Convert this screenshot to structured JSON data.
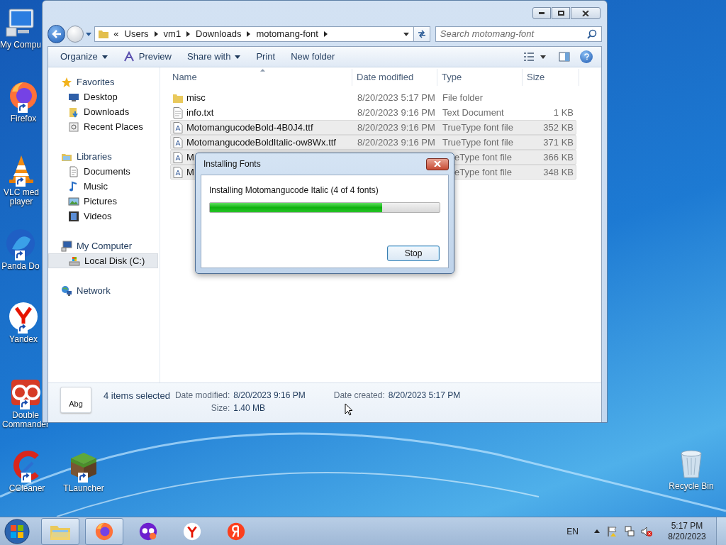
{
  "desktop_icons": [
    {
      "kind": "computer",
      "lines": [
        "My Compu"
      ],
      "shortcut": false
    },
    {
      "kind": "firefox",
      "lines": [
        "Firefox"
      ],
      "shortcut": true
    },
    {
      "kind": "vlc",
      "lines": [
        "VLC med",
        "player"
      ],
      "shortcut": true
    },
    {
      "kind": "panda",
      "lines": [
        "Panda Do"
      ],
      "shortcut": true
    },
    {
      "kind": "yandex",
      "lines": [
        "Yandex"
      ],
      "shortcut": true
    },
    {
      "kind": "doublecmd",
      "lines": [
        "Double",
        "Commander"
      ],
      "shortcut": true
    },
    {
      "kind": "ccleaner",
      "lines": [
        "CCleaner"
      ],
      "shortcut": true
    },
    {
      "kind": "tlauncher",
      "lines": [
        "TLauncher"
      ],
      "shortcut": true
    },
    {
      "kind": "recycle",
      "lines": [
        "Recycle Bin"
      ],
      "shortcut": false
    }
  ],
  "explorer": {
    "address": {
      "overflow": "«",
      "crumbs": [
        "Users",
        "vm1",
        "Downloads",
        "motomang-font"
      ]
    },
    "search": {
      "placeholder": "Search motomang-font"
    },
    "toolbar": [
      {
        "label": "Organize",
        "kind": "menu"
      },
      {
        "label": "Preview",
        "kind": "preview"
      },
      {
        "label": "Share with",
        "kind": "menu"
      },
      {
        "label": "Print",
        "kind": "plain"
      },
      {
        "label": "New folder",
        "kind": "plain"
      }
    ],
    "sidebar": [
      {
        "label": "Favorites",
        "kind": "star",
        "selected": false,
        "children": [
          {
            "label": "Desktop",
            "kind": "desktop",
            "selected": false
          },
          {
            "label": "Downloads",
            "kind": "downloads",
            "selected": false
          },
          {
            "label": "Recent Places",
            "kind": "recent",
            "selected": false
          }
        ]
      },
      {
        "label": "Libraries",
        "kind": "library",
        "selected": false,
        "children": [
          {
            "label": "Documents",
            "kind": "document",
            "selected": false
          },
          {
            "label": "Music",
            "kind": "music",
            "selected": false
          },
          {
            "label": "Pictures",
            "kind": "pictures",
            "selected": false
          },
          {
            "label": "Videos",
            "kind": "videos",
            "selected": false
          }
        ]
      },
      {
        "label": "My Computer",
        "kind": "computer",
        "selected": false,
        "children": [
          {
            "label": "Local Disk (C:)",
            "kind": "disk",
            "selected": true
          }
        ]
      },
      {
        "label": "Network",
        "kind": "network",
        "selected": false
      }
    ],
    "files": {
      "columns": [
        {
          "label": "Name",
          "sorted": true
        },
        {
          "label": "Date modified",
          "sorted": false
        },
        {
          "label": "Type",
          "sorted": false
        },
        {
          "label": "Size",
          "sorted": false
        }
      ],
      "rows": [
        {
          "kind": "folder",
          "name": "misc",
          "date": "8/20/2023 5:17 PM",
          "type": "File folder",
          "selected": false,
          "partly_hidden": false
        },
        {
          "kind": "text",
          "name": "info.txt",
          "date": "8/20/2023 9:16 PM",
          "type": "Text Document",
          "size": "1 KB",
          "selected": false,
          "partly_hidden": false
        },
        {
          "kind": "font",
          "name": "MotomangucodeBold-4B0J4.ttf",
          "date": "8/20/2023 9:16 PM",
          "type": "TrueType font file",
          "size": "352 KB",
          "selected": true,
          "partly_hidden": false
        },
        {
          "kind": "font",
          "name": "MotomangucodeBoldItalic-ow8Wx.ttf",
          "date": "8/20/2023 9:16 PM",
          "type": "TrueType font file",
          "size": "371 KB",
          "selected": true,
          "partly_hidden": false
        },
        {
          "kind": "font",
          "name": "M",
          "type": "eType font file",
          "size": "366 KB",
          "selected": true,
          "partly_hidden": true
        },
        {
          "kind": "font",
          "name": "M",
          "type": "eType font file",
          "size": "348 KB",
          "selected": true,
          "partly_hidden": true
        }
      ]
    },
    "details": {
      "thumbnail_text": "Abg",
      "summary": "4 items selected",
      "columns": [
        [
          {
            "label": "Date modified:",
            "value": "8/20/2023 9:16 PM"
          },
          {
            "label": "Size:",
            "value": "1.40 MB"
          }
        ],
        [
          {
            "label": "Date created:",
            "value": "8/20/2023 5:17 PM"
          }
        ]
      ]
    }
  },
  "dialog": {
    "title": "Installing Fonts",
    "message": "Installing Motomangucode Italic (4 of 4 fonts)",
    "level": 0.75,
    "button": "Stop"
  },
  "taskbar": {
    "apps": [
      {
        "kind": "explorer",
        "open": true
      },
      {
        "kind": "firefox",
        "open": true
      },
      {
        "kind": "mask",
        "open": false
      },
      {
        "kind": "yandex",
        "open": false
      },
      {
        "kind": "yandex-red",
        "open": false
      }
    ],
    "language": "EN",
    "time": "5:17 PM",
    "date": "8/20/2023"
  }
}
